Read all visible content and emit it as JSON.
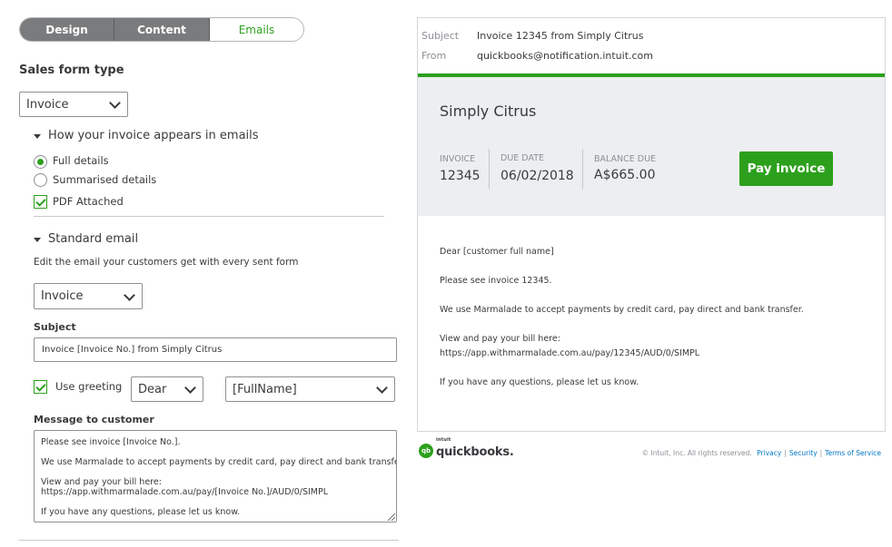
{
  "tabs": [
    {
      "label": "Design"
    },
    {
      "label": "Content"
    },
    {
      "label": "Emails"
    }
  ],
  "sales_form": {
    "heading": "Sales form type",
    "selected": "Invoice"
  },
  "appearance": {
    "title": "How your invoice appears in emails",
    "full_details": "Full details",
    "summarised_details": "Summarised details",
    "pdf_attached": "PDF Attached"
  },
  "standard_email": {
    "title": "Standard email",
    "description": "Edit the email your customers get with every sent form",
    "selected": "Invoice"
  },
  "subject": {
    "label": "Subject",
    "value": "Invoice [Invoice No.] from Simply Citrus"
  },
  "greeting": {
    "label": "Use greeting",
    "salutation": "Dear",
    "name_field": "[FullName]"
  },
  "message": {
    "label": "Message to customer",
    "lines": [
      "Please see invoice [Invoice No.].",
      "We use Marmalade to accept payments by credit card, pay direct and bank transfer.",
      "View and pay your bill here:",
      "https://app.withmarmalade.com.au/pay/[Invoice No.]/AUD/0/SIMPL",
      "If you have any questions, please let us know."
    ]
  },
  "preview": {
    "subject_label": "Subject",
    "subject_value": "Invoice 12345 from Simply Citrus",
    "from_label": "From",
    "from_value": "quickbooks@notification.intuit.com",
    "company": "Simply Citrus",
    "invoice_label": "INVOICE",
    "invoice_value": "12345",
    "due_label": "DUE DATE",
    "due_value": "06/02/2018",
    "balance_label": "BALANCE DUE",
    "balance_value": "A$665.00",
    "pay_button": "Pay invoice",
    "body": [
      "Dear [customer full name]",
      "Please see invoice 12345.",
      "We use Marmalade to accept payments by credit card, pay direct and bank transfer.",
      "View and pay your bill here:",
      "https://app.withmarmalade.com.au/pay/12345/AUD/0/SIMPL",
      "If you have any questions, please let us know."
    ]
  },
  "footer": {
    "logo_mark": "qb",
    "logo_intuit": "intuit",
    "logo_word": "quickbooks.",
    "copyright": "© Intuit, Inc. All rights reserved.",
    "privacy": "Privacy",
    "security": "Security",
    "terms": "Terms of Service",
    "separator": "|"
  },
  "colors": {
    "brand_green": "#2ca01c",
    "tab_dark": "#7a7b7d",
    "banner_bg": "#eceef1",
    "link_blue": "#0077c5"
  }
}
